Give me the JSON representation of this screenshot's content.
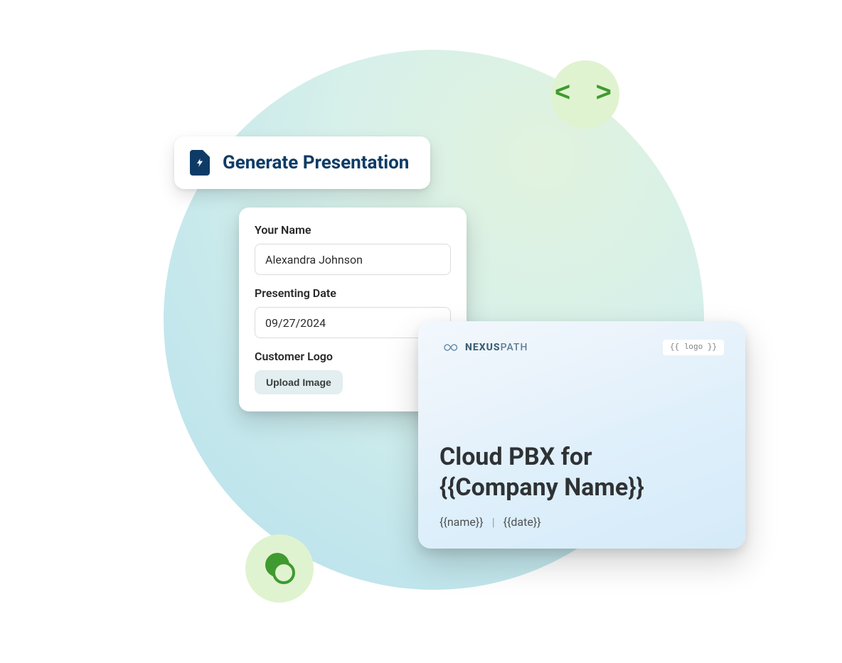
{
  "generate": {
    "label": "Generate Presentation"
  },
  "form": {
    "name_label": "Your Name",
    "name_value": "Alexandra Johnson",
    "date_label": "Presenting Date",
    "date_value": "09/27/2024",
    "logo_label": "Customer Logo",
    "upload_label": "Upload Image"
  },
  "slide": {
    "brand_prefix": "NEXUS",
    "brand_suffix": "PATH",
    "logo_placeholder": "{{ logo }}",
    "title_line1": "Cloud PBX for",
    "title_line2": "{{Company Name}}",
    "meta_name": "{{name}}",
    "meta_sep": "|",
    "meta_date": "{{date}}"
  },
  "icons": {
    "code": "< >",
    "chat": "chat-icon",
    "file_bolt": "file-bolt-icon",
    "infinity": "infinity-icon"
  },
  "colors": {
    "accent_navy": "#0e3b66",
    "accent_green": "#3f9a2f",
    "badge_bg": "#e0f3d0"
  }
}
